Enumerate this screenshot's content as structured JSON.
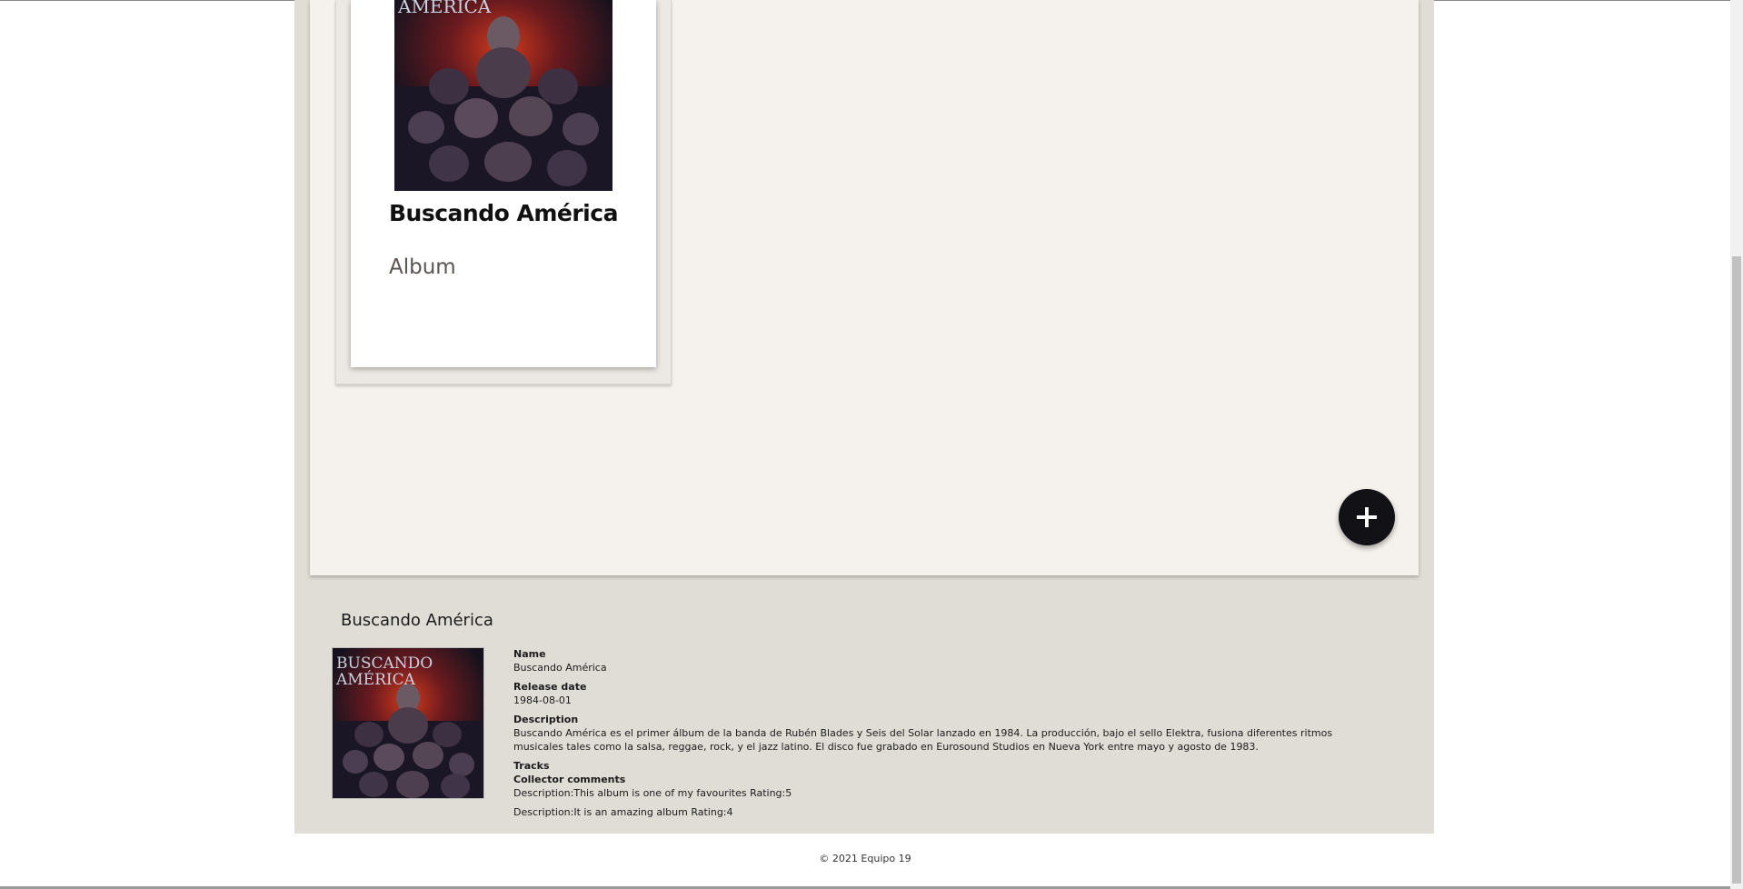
{
  "album_card": {
    "title": "Buscando América",
    "subtitle": "Album",
    "cover_icon": "album-cover-image",
    "cover_text": "AMÉRICA"
  },
  "add_button": {
    "icon": "plus-icon"
  },
  "detail": {
    "title": "Buscando América",
    "cover_text_top": "BUSCANDO",
    "cover_text_bottom": "AMÉRICA",
    "name_label": "Name",
    "name_value": "Buscando América",
    "release_label": "Release date",
    "release_value": "1984-08-01",
    "description_label": "Description",
    "description_value": "Buscando América es el primer álbum de la banda de Rubén Blades y Seis del Solar lanzado en 1984. La producción, bajo el sello Elektra, fusiona diferentes ritmos musicales tales como la salsa, reggae, rock, y el jazz latino. El disco fue grabado en Eurosound Studios en Nueva York entre mayo y agosto de 1983.",
    "tracks_label": "Tracks",
    "comments_label": "Collector comments",
    "comments": [
      "Description:This album is one of my favourites Rating:5",
      "Description:It is an amazing album Rating:4"
    ]
  },
  "footer": {
    "text": "© 2021 Equipo 19"
  },
  "colors": {
    "panel_bg": "#f5f1ec",
    "page_bg": "#e0dcd6",
    "fab_bg": "#111116"
  }
}
